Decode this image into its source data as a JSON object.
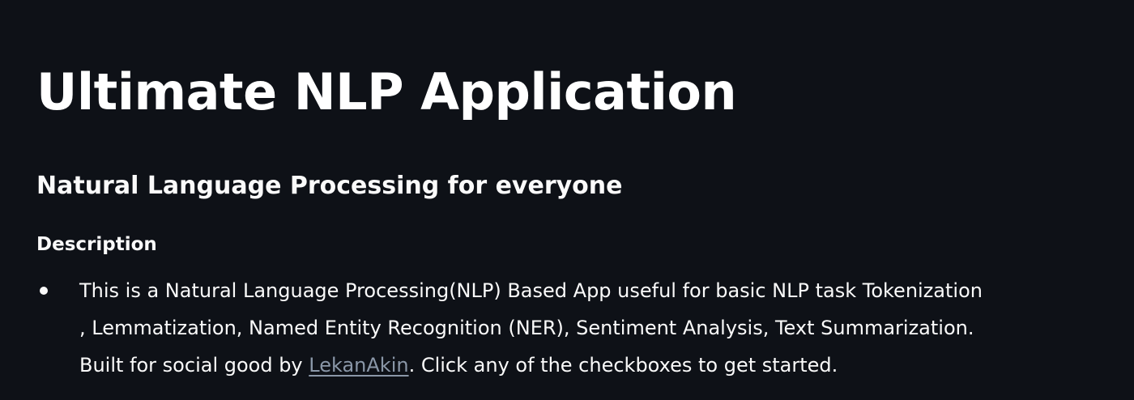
{
  "main": {
    "title": "Ultimate NLP Application",
    "subtitle": "Natural Language Processing for everyone",
    "description_heading": "Description",
    "description": {
      "line1": "This is a Natural Language Processing(NLP) Based App useful for basic NLP task Tokenization",
      "line2": ", Lemmatization, Named Entity Recognition (NER), Sentiment Analysis, Text Summarization.",
      "line3_before": "Built for social good by ",
      "link_text": "LekanAkin",
      "line3_after": ". Click any of the checkboxes to get started."
    }
  },
  "colors": {
    "background": "#0e1117",
    "text": "#fafafa",
    "link": "#8a97a8"
  }
}
